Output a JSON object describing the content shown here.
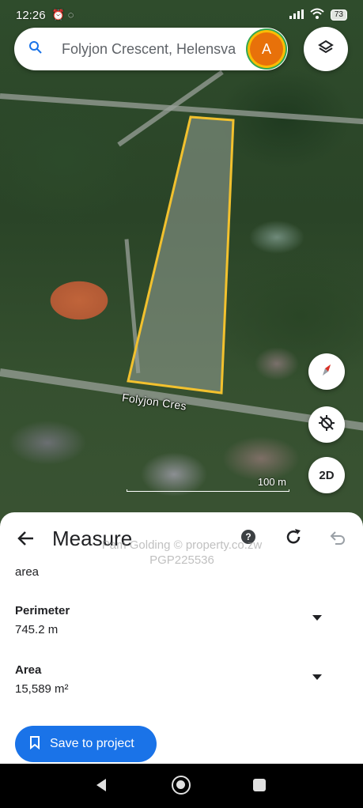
{
  "status_bar": {
    "time": "12:26",
    "left_icons": [
      "alarm-icon",
      "whatsapp-icon"
    ],
    "battery": "73"
  },
  "search": {
    "text": "Folyjon Crescent, Helensva",
    "avatar_initial": "A"
  },
  "map": {
    "street_label": "Folyjon Cres",
    "scale_label": "100 m",
    "view_mode_button": "2D",
    "plot_outline_color": "#f2c12e"
  },
  "sheet": {
    "title": "Measure",
    "watermark_line1": "Pam Golding  ©  property.co.zw",
    "watermark_line2": "PGP225536",
    "section_label": "area",
    "perimeter": {
      "name": "Perimeter",
      "value": "745.2 m"
    },
    "area": {
      "name": "Area",
      "value": "15,589 m²"
    },
    "save_label": "Save to project"
  },
  "colors": {
    "accent": "#1a73e8",
    "avatar": "#e8710a"
  }
}
